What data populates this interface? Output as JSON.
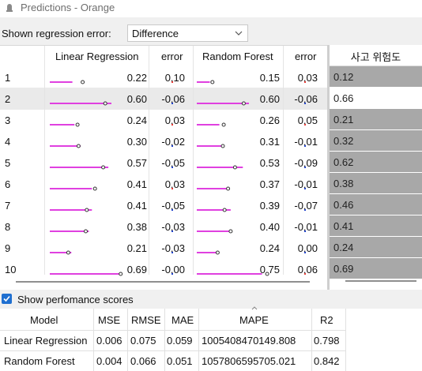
{
  "window": {
    "title": "Predictions - Orange",
    "icon": "orange-app-icon"
  },
  "controls": {
    "error_label": "Shown regression error:",
    "error_value": "Difference"
  },
  "table": {
    "headers": [
      "Linear Regression",
      "error",
      "Random Forest",
      "error"
    ],
    "rows": [
      {
        "num": "1",
        "lr": "0.22",
        "lr_err": "0.10",
        "rf": "0.15",
        "rf_err": "0.03"
      },
      {
        "num": "2",
        "lr": "0.60",
        "lr_err": "-0.06",
        "rf": "0.60",
        "rf_err": "-0.06"
      },
      {
        "num": "3",
        "lr": "0.24",
        "lr_err": "0.03",
        "rf": "0.26",
        "rf_err": "0.05"
      },
      {
        "num": "4",
        "lr": "0.30",
        "lr_err": "-0.02",
        "rf": "0.31",
        "rf_err": "-0.01"
      },
      {
        "num": "5",
        "lr": "0.57",
        "lr_err": "-0.05",
        "rf": "0.53",
        "rf_err": "-0.09"
      },
      {
        "num": "6",
        "lr": "0.41",
        "lr_err": "0.03",
        "rf": "0.37",
        "rf_err": "-0.01"
      },
      {
        "num": "7",
        "lr": "0.41",
        "lr_err": "-0.05",
        "rf": "0.39",
        "rf_err": "-0.07"
      },
      {
        "num": "8",
        "lr": "0.38",
        "lr_err": "-0.03",
        "rf": "0.40",
        "rf_err": "-0.01"
      },
      {
        "num": "9",
        "lr": "0.21",
        "lr_err": "-0.03",
        "rf": "0.24",
        "rf_err": "0.00"
      },
      {
        "num": "10",
        "lr": "0.69",
        "lr_err": "-0.00",
        "rf": "0.75",
        "rf_err": "0.06"
      }
    ],
    "selected_row": 2
  },
  "risk": {
    "header": "사고 위험도",
    "values": [
      "0.12",
      "0.66",
      "0.21",
      "0.32",
      "0.62",
      "0.38",
      "0.46",
      "0.41",
      "0.24",
      "0.69"
    ]
  },
  "performance": {
    "checkbox_label": "Show perfomance scores",
    "checked": true,
    "headers": [
      "Model",
      "MSE",
      "RMSE",
      "MAE",
      "MAPE",
      "R2"
    ],
    "rows": [
      [
        "Linear Regression",
        "0.006",
        "0.075",
        "0.059",
        "1005408470149.808",
        "0.798"
      ],
      [
        "Random Forest",
        "0.004",
        "0.066",
        "0.051",
        "1057806595705.021",
        "0.842"
      ]
    ]
  },
  "colors": {
    "bar": "#e040e0",
    "error_pos": "#e53935",
    "error_neg": "#1e40c8",
    "risk_cell": "#a8a8a8",
    "checkbox": "#1f6fd0"
  }
}
